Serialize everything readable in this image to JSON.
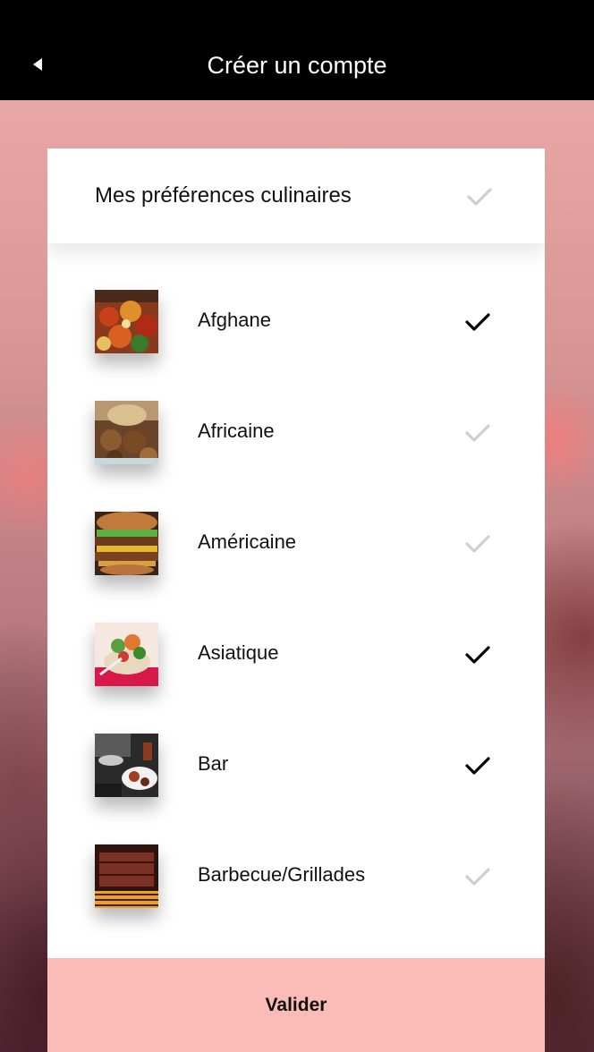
{
  "header": {
    "title": "Créer un compte"
  },
  "preferences": {
    "title": "Mes préférences culinaires",
    "all_selected": false,
    "items": [
      {
        "label": "Afghane",
        "checked": true
      },
      {
        "label": "Africaine",
        "checked": false
      },
      {
        "label": "Américaine",
        "checked": false
      },
      {
        "label": "Asiatique",
        "checked": true
      },
      {
        "label": "Bar",
        "checked": true
      },
      {
        "label": "Barbecue/Grillades",
        "checked": false
      }
    ]
  },
  "footer": {
    "validate_label": "Valider"
  },
  "colors": {
    "header_bg": "#000000",
    "button_bg": "#fbbcb7",
    "check_on": "#000000",
    "check_off": "#cfcfcf"
  }
}
